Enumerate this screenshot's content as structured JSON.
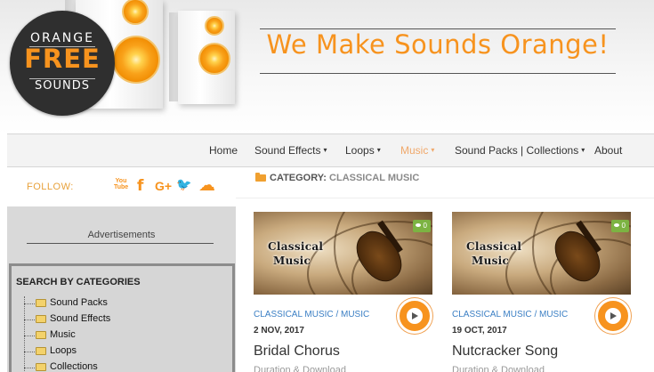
{
  "header": {
    "logo": {
      "line1": "ORANGE",
      "line2": "FREE",
      "line3": "SOUNDS"
    },
    "slogan": "We Make Sounds Orange!"
  },
  "nav": {
    "items": [
      {
        "label": "Home",
        "has_dropdown": false,
        "active": false
      },
      {
        "label": "Sound Effects",
        "has_dropdown": true,
        "active": false
      },
      {
        "label": "Loops",
        "has_dropdown": true,
        "active": false
      },
      {
        "label": "Music",
        "has_dropdown": true,
        "active": true
      },
      {
        "label": "Sound Packs | Collections",
        "has_dropdown": true,
        "active": false
      },
      {
        "label": "About",
        "has_dropdown": false,
        "active": false
      }
    ],
    "caret": "▾"
  },
  "follow": {
    "label": "FOLLOW:",
    "icons": [
      "youtube-icon",
      "facebook-icon",
      "google-plus-icon",
      "twitter-icon",
      "soundcloud-icon"
    ],
    "youtube_text": "You Tube",
    "facebook_text": "f",
    "google_plus_text": "G+",
    "twitter_text": "🐦",
    "soundcloud_text": "☁"
  },
  "category": {
    "prefix": "CATEGORY:",
    "name": "CLASSICAL MUSIC"
  },
  "sidebar": {
    "ads_label": "Advertisements",
    "categories_title": "SEARCH BY CATEGORIES",
    "tree": [
      "Sound Packs",
      "Sound Effects",
      "Music",
      "Loops",
      "Collections"
    ]
  },
  "posts": [
    {
      "thumb_text_1": "Classical",
      "thumb_text_2": "Music",
      "views": "0",
      "category": "CLASSICAL MUSIC",
      "separator": "/",
      "category2": "MUSIC",
      "date": "2 NOV, 2017",
      "title": "Bridal Chorus",
      "subtitle": "Duration & Download"
    },
    {
      "thumb_text_1": "Classical",
      "thumb_text_2": "Music",
      "views": "0",
      "category": "CLASSICAL MUSIC",
      "separator": "/",
      "category2": "MUSIC",
      "date": "19 OCT, 2017",
      "title": "Nutcracker Song",
      "subtitle": "Duration & Download"
    }
  ],
  "colors": {
    "brand_orange": "#f7931e",
    "link_blue": "#3b7fc4",
    "badge_green": "#7cb342"
  }
}
